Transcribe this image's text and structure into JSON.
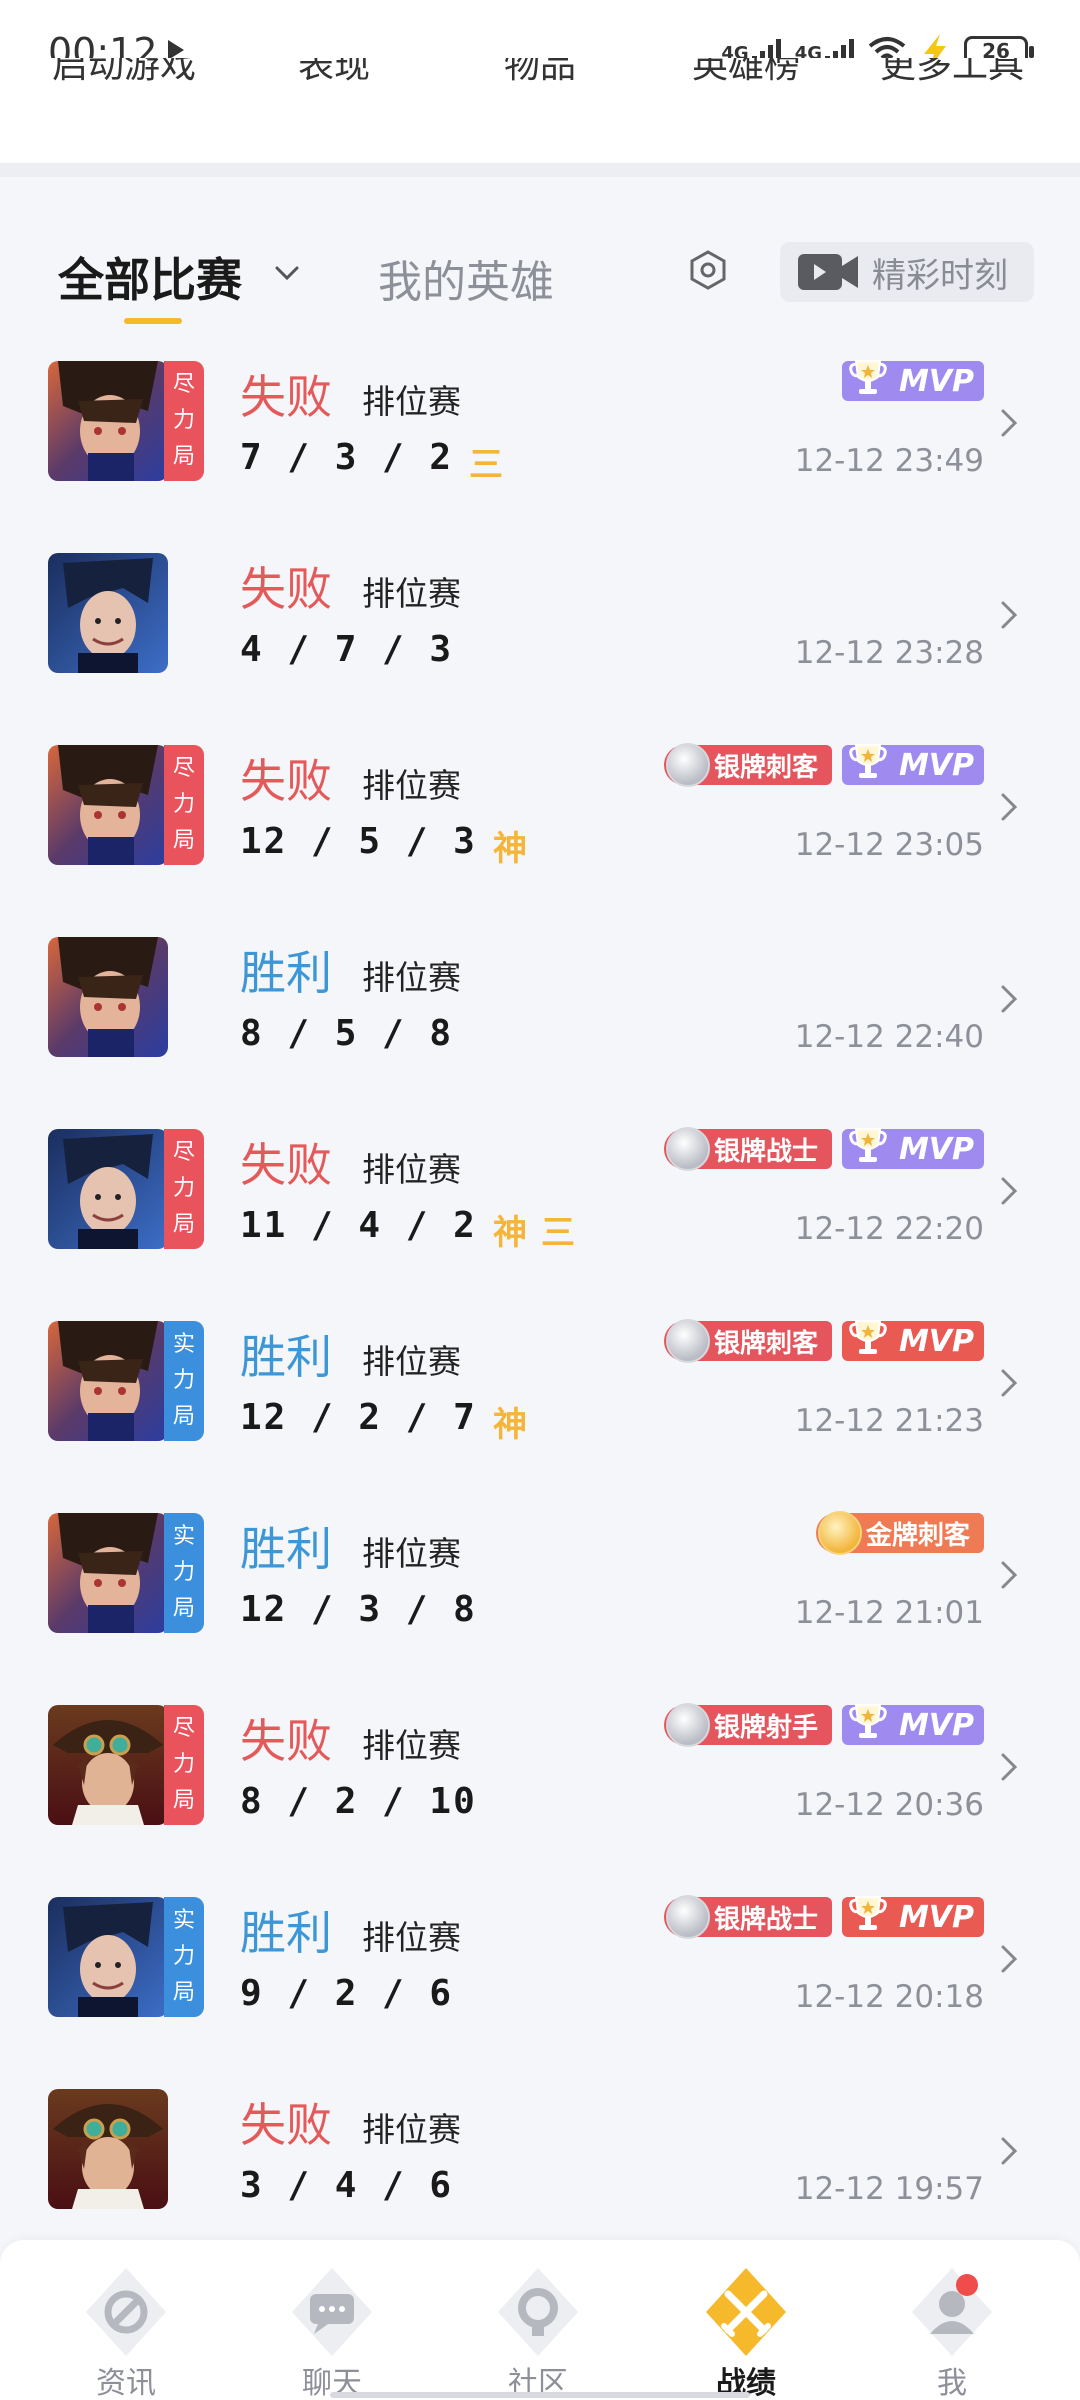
{
  "status_bar": {
    "time": "00:12",
    "signal1": "4G",
    "signal2": "4G",
    "battery": "26"
  },
  "top_nav": {
    "items": [
      "启动游戏",
      "表现",
      "物品",
      "英雄榜",
      "更多工具"
    ]
  },
  "tabs": {
    "all_matches": "全部比赛",
    "my_heroes": "我的英雄",
    "highlights": "精彩时刻"
  },
  "matches": [
    {
      "result": "失败",
      "outcome": "lose",
      "mode": "排位赛",
      "kda": "7 / 3 / 2",
      "marks": [
        "三"
      ],
      "tag": "尽力局",
      "tag_color": "red",
      "medal": "",
      "mvp": "MVP",
      "mvp_color": "purple",
      "time": "12-12 23:49",
      "hero": "hero-a"
    },
    {
      "result": "失败",
      "outcome": "lose",
      "mode": "排位赛",
      "kda": "4 / 7 / 3",
      "marks": [],
      "tag": "",
      "tag_color": "",
      "medal": "",
      "mvp": "",
      "mvp_color": "",
      "time": "12-12 23:28",
      "hero": "hero-b"
    },
    {
      "result": "失败",
      "outcome": "lose",
      "mode": "排位赛",
      "kda": "12 / 5 / 3",
      "marks": [
        "神"
      ],
      "tag": "尽力局",
      "tag_color": "red",
      "medal": "银牌刺客",
      "medal_type": "silver",
      "mvp": "MVP",
      "mvp_color": "purple",
      "time": "12-12 23:05",
      "hero": "hero-a"
    },
    {
      "result": "胜利",
      "outcome": "win",
      "mode": "排位赛",
      "kda": "8 / 5 / 8",
      "marks": [],
      "tag": "",
      "tag_color": "",
      "medal": "",
      "mvp": "",
      "mvp_color": "",
      "time": "12-12 22:40",
      "hero": "hero-a"
    },
    {
      "result": "失败",
      "outcome": "lose",
      "mode": "排位赛",
      "kda": "11 / 4 / 2",
      "marks": [
        "神",
        "三"
      ],
      "tag": "尽力局",
      "tag_color": "red",
      "medal": "银牌战士",
      "medal_type": "silver",
      "mvp": "MVP",
      "mvp_color": "purple",
      "time": "12-12 22:20",
      "hero": "hero-b"
    },
    {
      "result": "胜利",
      "outcome": "win",
      "mode": "排位赛",
      "kda": "12 / 2 / 7",
      "marks": [
        "神"
      ],
      "tag": "实力局",
      "tag_color": "blue",
      "medal": "银牌刺客",
      "medal_type": "silver",
      "mvp": "MVP",
      "mvp_color": "red",
      "time": "12-12 21:23",
      "hero": "hero-a"
    },
    {
      "result": "胜利",
      "outcome": "win",
      "mode": "排位赛",
      "kda": "12 / 3 / 8",
      "marks": [],
      "tag": "实力局",
      "tag_color": "blue",
      "medal": "金牌刺客",
      "medal_type": "gold",
      "mvp": "",
      "mvp_color": "",
      "time": "12-12 21:01",
      "hero": "hero-a"
    },
    {
      "result": "失败",
      "outcome": "lose",
      "mode": "排位赛",
      "kda": "8 / 2 / 10",
      "marks": [],
      "tag": "尽力局",
      "tag_color": "red",
      "medal": "银牌射手",
      "medal_type": "silver",
      "mvp": "MVP",
      "mvp_color": "purple",
      "time": "12-12 20:36",
      "hero": "hero-c"
    },
    {
      "result": "胜利",
      "outcome": "win",
      "mode": "排位赛",
      "kda": "9 / 2 / 6",
      "marks": [],
      "tag": "实力局",
      "tag_color": "blue",
      "medal": "银牌战士",
      "medal_type": "silver",
      "mvp": "MVP",
      "mvp_color": "red",
      "time": "12-12 20:18",
      "hero": "hero-b"
    },
    {
      "result": "失败",
      "outcome": "lose",
      "mode": "排位赛",
      "kda": "3 / 4 / 6",
      "marks": [],
      "tag": "",
      "tag_color": "",
      "medal": "",
      "mvp": "",
      "mvp_color": "",
      "time": "12-12 19:57",
      "hero": "hero-c"
    }
  ],
  "bottom_nav": [
    {
      "label": "资讯",
      "icon": "news-icon",
      "active": false
    },
    {
      "label": "聊天",
      "icon": "chat-icon",
      "active": false
    },
    {
      "label": "社区",
      "icon": "community-icon",
      "active": false
    },
    {
      "label": "战绩",
      "icon": "record-icon",
      "active": true
    },
    {
      "label": "我",
      "icon": "profile-icon",
      "active": false
    }
  ],
  "colors": {
    "lose": "#e45a5a",
    "win": "#3d97d6",
    "accent": "#f6b92b",
    "mvp_purple": "#9f8bef",
    "mvp_red": "#e85a52"
  }
}
